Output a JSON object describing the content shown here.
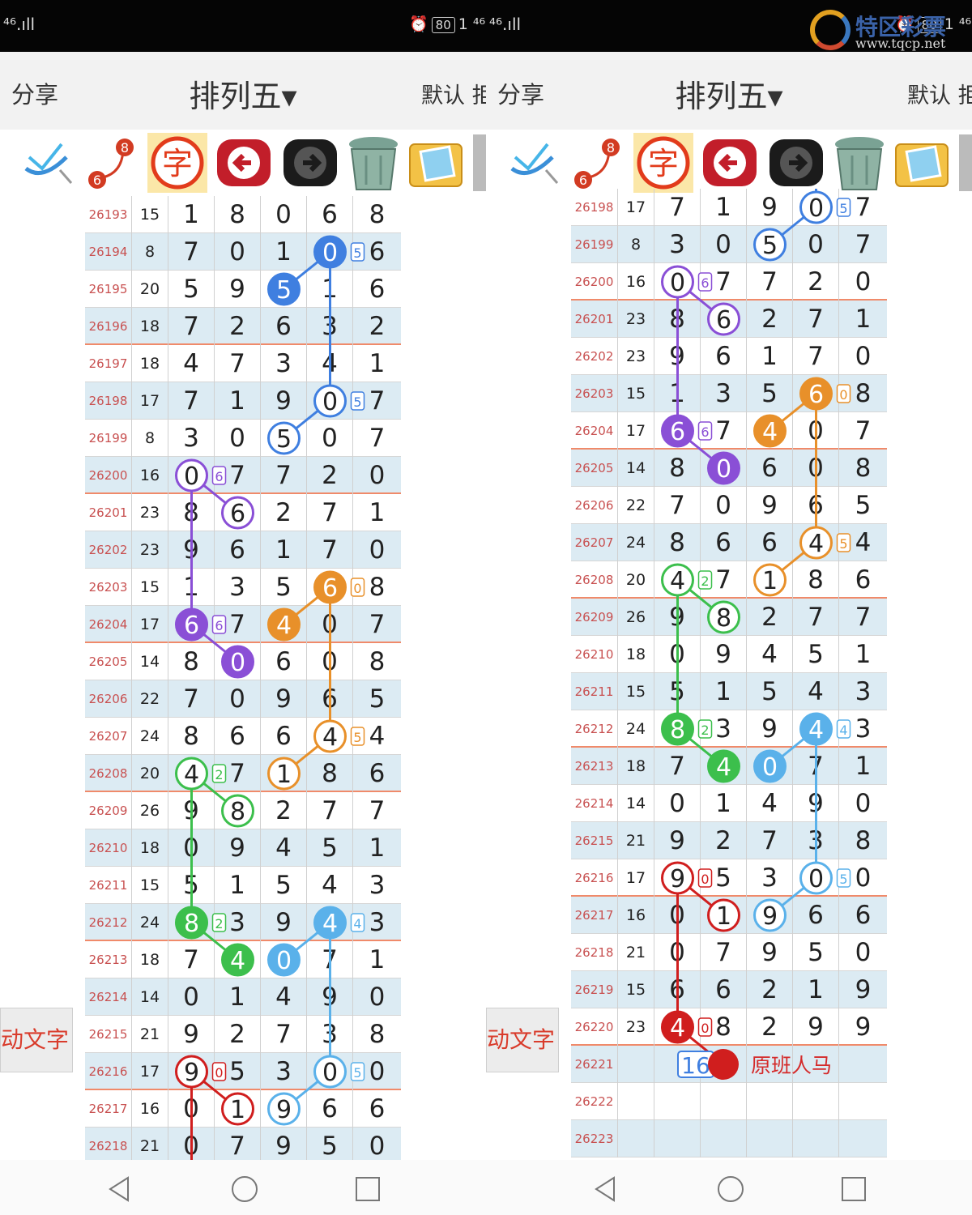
{
  "status": {
    "left_text": "⁴⁶.ıll",
    "battery": "80",
    "right_text": "1 ⁴⁶.ıll"
  },
  "header": {
    "share_label": "分享",
    "title": "排列五▾",
    "default_label": "默认 拒"
  },
  "toolbar": {
    "tools": [
      "pen-check-icon",
      "number-pick-icon",
      "char-icon",
      "back-arrow-icon",
      "forward-arrow-icon",
      "trash-icon",
      "image-icon"
    ],
    "badge_8": "8",
    "badge_6": "6",
    "char_label": "字"
  },
  "side_button_label": "动文字",
  "watermark": {
    "text": "特区彩票",
    "url": "www.tqcp.net"
  },
  "colors": {
    "purple": "#8a4fd6",
    "orange": "#e8902a",
    "blue": "#3f7fe0",
    "lightblue": "#5ab1ea",
    "green": "#3cbf4c",
    "red": "#d01e1e"
  },
  "left_rows": [
    {
      "issue": "26193",
      "sum": "15",
      "d": [
        "1",
        "8",
        "0",
        "6",
        "8"
      ]
    },
    {
      "issue": "26194",
      "sum": "8",
      "d": [
        "7",
        "0",
        "1",
        "",
        "6"
      ]
    },
    {
      "issue": "26195",
      "sum": "20",
      "d": [
        "5",
        "9",
        "",
        "1",
        "6"
      ]
    },
    {
      "issue": "26196",
      "sum": "18",
      "d": [
        "7",
        "2",
        "6",
        "3",
        "2"
      ]
    },
    {
      "issue": "26197",
      "sum": "18",
      "d": [
        "4",
        "7",
        "3",
        "4",
        "1"
      ]
    },
    {
      "issue": "26198",
      "sum": "17",
      "d": [
        "7",
        "1",
        "9",
        "",
        "7"
      ]
    },
    {
      "issue": "26199",
      "sum": "8",
      "d": [
        "3",
        "0",
        "",
        "0",
        "7"
      ]
    },
    {
      "issue": "26200",
      "sum": "16",
      "d": [
        "",
        "7",
        "7",
        "2",
        "0"
      ]
    },
    {
      "issue": "26201",
      "sum": "23",
      "d": [
        "8",
        "",
        "2",
        "7",
        "1"
      ]
    },
    {
      "issue": "26202",
      "sum": "23",
      "d": [
        "9",
        "6",
        "1",
        "7",
        "0"
      ]
    },
    {
      "issue": "26203",
      "sum": "15",
      "d": [
        "1",
        "3",
        "5",
        "",
        "8"
      ]
    },
    {
      "issue": "26204",
      "sum": "17",
      "d": [
        "",
        "7",
        "",
        "0",
        "7"
      ]
    },
    {
      "issue": "26205",
      "sum": "14",
      "d": [
        "8",
        "",
        "6",
        "0",
        "8"
      ]
    },
    {
      "issue": "26206",
      "sum": "22",
      "d": [
        "7",
        "0",
        "9",
        "6",
        "5"
      ]
    },
    {
      "issue": "26207",
      "sum": "24",
      "d": [
        "8",
        "6",
        "6",
        "",
        "4"
      ]
    },
    {
      "issue": "26208",
      "sum": "20",
      "d": [
        "",
        "7",
        "",
        "8",
        "6"
      ]
    },
    {
      "issue": "26209",
      "sum": "26",
      "d": [
        "9",
        "",
        "2",
        "7",
        "7"
      ]
    },
    {
      "issue": "26210",
      "sum": "18",
      "d": [
        "0",
        "9",
        "4",
        "5",
        "1"
      ]
    },
    {
      "issue": "26211",
      "sum": "15",
      "d": [
        "5",
        "1",
        "5",
        "4",
        "3"
      ]
    },
    {
      "issue": "26212",
      "sum": "24",
      "d": [
        "",
        "3",
        "9",
        "",
        "3"
      ]
    },
    {
      "issue": "26213",
      "sum": "18",
      "d": [
        "7",
        "",
        "",
        "7",
        "1"
      ]
    },
    {
      "issue": "26214",
      "sum": "14",
      "d": [
        "0",
        "1",
        "4",
        "9",
        "0"
      ]
    },
    {
      "issue": "26215",
      "sum": "21",
      "d": [
        "9",
        "2",
        "7",
        "3",
        "8"
      ]
    },
    {
      "issue": "26216",
      "sum": "17",
      "d": [
        "",
        "5",
        "3",
        "",
        "0"
      ]
    },
    {
      "issue": "26217",
      "sum": "16",
      "d": [
        "0",
        "",
        "",
        "6",
        "6"
      ]
    },
    {
      "issue": "26218",
      "sum": "21",
      "d": [
        "0",
        "7",
        "9",
        "5",
        "0"
      ]
    }
  ],
  "right_rows": [
    {
      "issue": "26198",
      "sum": "17",
      "d": [
        "7",
        "1",
        "9",
        "",
        "7"
      ]
    },
    {
      "issue": "26199",
      "sum": "8",
      "d": [
        "3",
        "0",
        "",
        "0",
        "7"
      ]
    },
    {
      "issue": "26200",
      "sum": "16",
      "d": [
        "",
        "7",
        "7",
        "2",
        "0"
      ]
    },
    {
      "issue": "26201",
      "sum": "23",
      "d": [
        "8",
        "",
        "2",
        "7",
        "1"
      ]
    },
    {
      "issue": "26202",
      "sum": "23",
      "d": [
        "9",
        "6",
        "1",
        "7",
        "0"
      ]
    },
    {
      "issue": "26203",
      "sum": "15",
      "d": [
        "1",
        "3",
        "5",
        "",
        "8"
      ]
    },
    {
      "issue": "26204",
      "sum": "17",
      "d": [
        "",
        "7",
        "",
        "0",
        "7"
      ]
    },
    {
      "issue": "26205",
      "sum": "14",
      "d": [
        "8",
        "",
        "6",
        "0",
        "8"
      ]
    },
    {
      "issue": "26206",
      "sum": "22",
      "d": [
        "7",
        "0",
        "9",
        "6",
        "5"
      ]
    },
    {
      "issue": "26207",
      "sum": "24",
      "d": [
        "8",
        "6",
        "6",
        "",
        "4"
      ]
    },
    {
      "issue": "26208",
      "sum": "20",
      "d": [
        "",
        "7",
        "",
        "8",
        "6"
      ]
    },
    {
      "issue": "26209",
      "sum": "26",
      "d": [
        "9",
        "",
        "2",
        "7",
        "7"
      ]
    },
    {
      "issue": "26210",
      "sum": "18",
      "d": [
        "0",
        "9",
        "4",
        "5",
        "1"
      ]
    },
    {
      "issue": "26211",
      "sum": "15",
      "d": [
        "5",
        "1",
        "5",
        "4",
        "3"
      ]
    },
    {
      "issue": "26212",
      "sum": "24",
      "d": [
        "",
        "3",
        "9",
        "",
        "3"
      ]
    },
    {
      "issue": "26213",
      "sum": "18",
      "d": [
        "7",
        "",
        "",
        "7",
        "1"
      ]
    },
    {
      "issue": "26214",
      "sum": "14",
      "d": [
        "0",
        "1",
        "4",
        "9",
        "0"
      ]
    },
    {
      "issue": "26215",
      "sum": "21",
      "d": [
        "9",
        "2",
        "7",
        "3",
        "8"
      ]
    },
    {
      "issue": "26216",
      "sum": "17",
      "d": [
        "",
        "5",
        "3",
        "",
        "0"
      ]
    },
    {
      "issue": "26217",
      "sum": "16",
      "d": [
        "0",
        "",
        "",
        "6",
        "6"
      ]
    },
    {
      "issue": "26218",
      "sum": "21",
      "d": [
        "0",
        "7",
        "9",
        "5",
        "0"
      ]
    },
    {
      "issue": "26219",
      "sum": "15",
      "d": [
        "6",
        "6",
        "2",
        "1",
        "9"
      ]
    },
    {
      "issue": "26220",
      "sum": "23",
      "d": [
        "",
        "8",
        "2",
        "9",
        "9"
      ]
    },
    {
      "issue": "26221",
      "sum": "",
      "d": [
        "",
        "",
        "",
        "",
        ""
      ]
    },
    {
      "issue": "26222",
      "sum": "",
      "d": [
        "",
        "",
        "",
        "",
        ""
      ]
    },
    {
      "issue": "26223",
      "sum": "",
      "d": [
        "",
        "",
        "",
        "",
        ""
      ]
    }
  ],
  "left_marks": [
    {
      "r": 1,
      "c": 3,
      "v": "0",
      "color": "blue",
      "filled": true,
      "tag": "5"
    },
    {
      "r": 2,
      "c": 2,
      "v": "5",
      "color": "blue",
      "filled": true
    },
    {
      "r": 5,
      "c": 3,
      "v": "0",
      "color": "blue",
      "filled": false,
      "tag": "5"
    },
    {
      "r": 6,
      "c": 2,
      "v": "5",
      "color": "blue",
      "filled": false
    },
    {
      "r": 7,
      "c": 0,
      "v": "0",
      "color": "purple",
      "filled": false,
      "tag": "6"
    },
    {
      "r": 8,
      "c": 1,
      "v": "6",
      "color": "purple",
      "filled": false
    },
    {
      "r": 10,
      "c": 3,
      "v": "6",
      "color": "orange",
      "filled": true,
      "tag": "0"
    },
    {
      "r": 11,
      "c": 0,
      "v": "6",
      "color": "purple",
      "filled": true,
      "tag": "6"
    },
    {
      "r": 11,
      "c": 2,
      "v": "4",
      "color": "orange",
      "filled": true
    },
    {
      "r": 12,
      "c": 1,
      "v": "0",
      "color": "purple",
      "filled": true
    },
    {
      "r": 14,
      "c": 3,
      "v": "4",
      "color": "orange",
      "filled": false,
      "tag": "5"
    },
    {
      "r": 15,
      "c": 0,
      "v": "4",
      "color": "green",
      "filled": false,
      "tag": "2"
    },
    {
      "r": 15,
      "c": 2,
      "v": "1",
      "color": "orange",
      "filled": false
    },
    {
      "r": 16,
      "c": 1,
      "v": "8",
      "color": "green",
      "filled": false
    },
    {
      "r": 19,
      "c": 0,
      "v": "8",
      "color": "green",
      "filled": true,
      "tag": "2"
    },
    {
      "r": 19,
      "c": 3,
      "v": "4",
      "color": "lightblue",
      "filled": true,
      "tag": "4"
    },
    {
      "r": 20,
      "c": 1,
      "v": "4",
      "color": "green",
      "filled": true
    },
    {
      "r": 20,
      "c": 2,
      "v": "0",
      "color": "lightblue",
      "filled": true
    },
    {
      "r": 23,
      "c": 0,
      "v": "9",
      "color": "red",
      "filled": false,
      "tag": "0"
    },
    {
      "r": 23,
      "c": 3,
      "v": "0",
      "color": "lightblue",
      "filled": false,
      "tag": "5"
    },
    {
      "r": 24,
      "c": 1,
      "v": "1",
      "color": "red",
      "filled": false
    },
    {
      "r": 24,
      "c": 2,
      "v": "9",
      "color": "lightblue",
      "filled": false
    }
  ],
  "right_marks": [
    {
      "r": 0,
      "c": 3,
      "v": "0",
      "color": "blue",
      "filled": false,
      "tag": "5"
    },
    {
      "r": 1,
      "c": 2,
      "v": "5",
      "color": "blue",
      "filled": false
    },
    {
      "r": 2,
      "c": 0,
      "v": "0",
      "color": "purple",
      "filled": false,
      "tag": "6"
    },
    {
      "r": 3,
      "c": 1,
      "v": "6",
      "color": "purple",
      "filled": false
    },
    {
      "r": 5,
      "c": 3,
      "v": "6",
      "color": "orange",
      "filled": true,
      "tag": "0"
    },
    {
      "r": 6,
      "c": 0,
      "v": "6",
      "color": "purple",
      "filled": true,
      "tag": "6"
    },
    {
      "r": 6,
      "c": 2,
      "v": "4",
      "color": "orange",
      "filled": true
    },
    {
      "r": 7,
      "c": 1,
      "v": "0",
      "color": "purple",
      "filled": true
    },
    {
      "r": 9,
      "c": 3,
      "v": "4",
      "color": "orange",
      "filled": false,
      "tag": "5"
    },
    {
      "r": 10,
      "c": 0,
      "v": "4",
      "color": "green",
      "filled": false,
      "tag": "2"
    },
    {
      "r": 10,
      "c": 2,
      "v": "1",
      "color": "orange",
      "filled": false
    },
    {
      "r": 11,
      "c": 1,
      "v": "8",
      "color": "green",
      "filled": false
    },
    {
      "r": 14,
      "c": 0,
      "v": "8",
      "color": "green",
      "filled": true,
      "tag": "2"
    },
    {
      "r": 14,
      "c": 3,
      "v": "4",
      "color": "lightblue",
      "filled": true,
      "tag": "4"
    },
    {
      "r": 15,
      "c": 1,
      "v": "4",
      "color": "green",
      "filled": true
    },
    {
      "r": 15,
      "c": 2,
      "v": "0",
      "color": "lightblue",
      "filled": true
    },
    {
      "r": 18,
      "c": 0,
      "v": "9",
      "color": "red",
      "filled": false,
      "tag": "0"
    },
    {
      "r": 18,
      "c": 3,
      "v": "0",
      "color": "lightblue",
      "filled": false,
      "tag": "5"
    },
    {
      "r": 19,
      "c": 1,
      "v": "1",
      "color": "red",
      "filled": false
    },
    {
      "r": 19,
      "c": 2,
      "v": "9",
      "color": "lightblue",
      "filled": false
    },
    {
      "r": 22,
      "c": 0,
      "v": "4",
      "color": "red",
      "filled": true,
      "tag": "0"
    }
  ],
  "left_lines": [
    {
      "color": "blue",
      "pts": [
        [
          5,
          3
        ],
        [
          6,
          2
        ]
      ]
    },
    {
      "color": "blue",
      "pts": [
        [
          1,
          3
        ],
        [
          2,
          2
        ]
      ]
    },
    {
      "color": "blue",
      "pts": [
        [
          1,
          3
        ],
        [
          5,
          3
        ]
      ]
    },
    {
      "color": "purple",
      "pts": [
        [
          7,
          0
        ],
        [
          8,
          1
        ]
      ]
    },
    {
      "color": "purple",
      "pts": [
        [
          7,
          0
        ],
        [
          11,
          0
        ]
      ]
    },
    {
      "color": "purple",
      "pts": [
        [
          11,
          0
        ],
        [
          12,
          1
        ]
      ]
    },
    {
      "color": "orange",
      "pts": [
        [
          10,
          3
        ],
        [
          11,
          2
        ]
      ]
    },
    {
      "color": "orange",
      "pts": [
        [
          10,
          3
        ],
        [
          14,
          3
        ]
      ]
    },
    {
      "color": "orange",
      "pts": [
        [
          14,
          3
        ],
        [
          15,
          2
        ]
      ]
    },
    {
      "color": "green",
      "pts": [
        [
          15,
          0
        ],
        [
          16,
          1
        ]
      ]
    },
    {
      "color": "green",
      "pts": [
        [
          15,
          0
        ],
        [
          19,
          0
        ]
      ]
    },
    {
      "color": "green",
      "pts": [
        [
          19,
          0
        ],
        [
          20,
          1
        ]
      ]
    },
    {
      "color": "lightblue",
      "pts": [
        [
          19,
          3
        ],
        [
          20,
          2
        ]
      ]
    },
    {
      "color": "lightblue",
      "pts": [
        [
          19,
          3
        ],
        [
          23,
          3
        ]
      ]
    },
    {
      "color": "lightblue",
      "pts": [
        [
          23,
          3
        ],
        [
          24,
          2
        ]
      ]
    },
    {
      "color": "red",
      "pts": [
        [
          23,
          0
        ],
        [
          24,
          1
        ]
      ]
    },
    {
      "color": "red",
      "pts": [
        [
          23,
          0
        ],
        [
          25.6,
          0
        ]
      ]
    }
  ],
  "right_lines": [
    {
      "color": "blue",
      "pts": [
        [
          0,
          3
        ],
        [
          1,
          2
        ]
      ]
    },
    {
      "color": "blue",
      "pts": [
        [
          -0.6,
          3
        ],
        [
          0,
          3
        ]
      ]
    },
    {
      "color": "purple",
      "pts": [
        [
          2,
          0
        ],
        [
          3,
          1
        ]
      ]
    },
    {
      "color": "purple",
      "pts": [
        [
          2,
          0
        ],
        [
          6,
          0
        ]
      ]
    },
    {
      "color": "purple",
      "pts": [
        [
          6,
          0
        ],
        [
          7,
          1
        ]
      ]
    },
    {
      "color": "orange",
      "pts": [
        [
          5,
          3
        ],
        [
          6,
          2
        ]
      ]
    },
    {
      "color": "orange",
      "pts": [
        [
          5,
          3
        ],
        [
          9,
          3
        ]
      ]
    },
    {
      "color": "orange",
      "pts": [
        [
          9,
          3
        ],
        [
          10,
          2
        ]
      ]
    },
    {
      "color": "green",
      "pts": [
        [
          10,
          0
        ],
        [
          11,
          1
        ]
      ]
    },
    {
      "color": "green",
      "pts": [
        [
          10,
          0
        ],
        [
          14,
          0
        ]
      ]
    },
    {
      "color": "green",
      "pts": [
        [
          14,
          0
        ],
        [
          15,
          1
        ]
      ]
    },
    {
      "color": "lightblue",
      "pts": [
        [
          14,
          3
        ],
        [
          15,
          2
        ]
      ]
    },
    {
      "color": "lightblue",
      "pts": [
        [
          14,
          3
        ],
        [
          18,
          3
        ]
      ]
    },
    {
      "color": "lightblue",
      "pts": [
        [
          18,
          3
        ],
        [
          19,
          2
        ]
      ]
    },
    {
      "color": "red",
      "pts": [
        [
          18,
          0
        ],
        [
          19,
          1
        ]
      ]
    },
    {
      "color": "red",
      "pts": [
        [
          18,
          0
        ],
        [
          22,
          0
        ]
      ]
    },
    {
      "color": "red",
      "pts": [
        [
          22,
          0
        ],
        [
          23,
          1
        ]
      ]
    }
  ],
  "prediction": {
    "number": "16",
    "label": "原班人马",
    "row": 23
  }
}
